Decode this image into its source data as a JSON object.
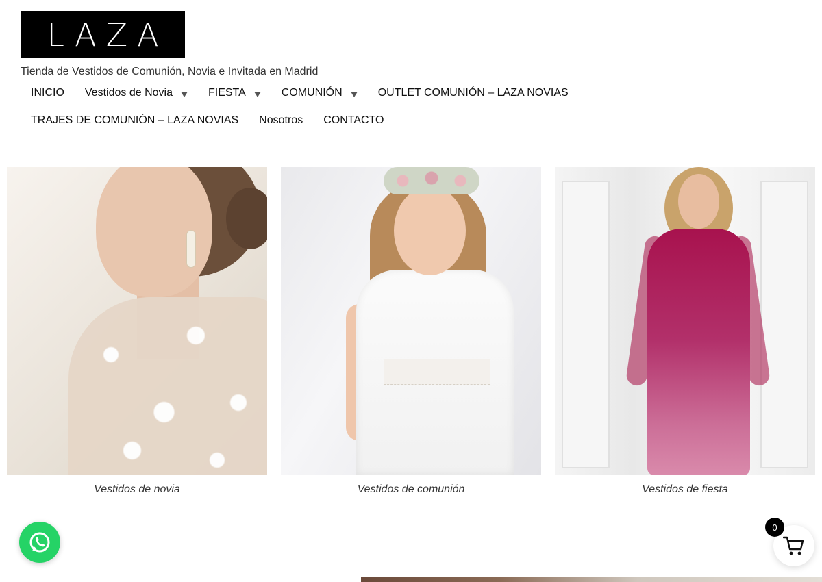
{
  "header": {
    "logo_text": "LAZA",
    "tagline": "Tienda de Vestidos de Comunión, Novia e Invitada en Madrid"
  },
  "nav": {
    "row1": [
      {
        "label": "INICIO",
        "has_dropdown": false
      },
      {
        "label": "Vestidos de Novia",
        "has_dropdown": true
      },
      {
        "label": "FIESTA",
        "has_dropdown": true
      },
      {
        "label": "COMUNIÓN",
        "has_dropdown": true
      },
      {
        "label": "OUTLET COMUNIÓN – LAZA NOVIAS",
        "has_dropdown": false
      }
    ],
    "row2": [
      {
        "label": "TRAJES DE COMUNIÓN – LAZA NOVIAS",
        "has_dropdown": false
      },
      {
        "label": "Nosotros",
        "has_dropdown": false
      },
      {
        "label": "CONTACTO",
        "has_dropdown": false
      }
    ]
  },
  "categories": [
    {
      "caption": "Vestidos de novia"
    },
    {
      "caption": "Vestidos de comunión"
    },
    {
      "caption": "Vestidos de fiesta"
    }
  ],
  "cart": {
    "count": "0",
    "icon": "shopping-cart-icon"
  },
  "whatsapp": {
    "icon": "whatsapp-icon",
    "color": "#25d366"
  }
}
